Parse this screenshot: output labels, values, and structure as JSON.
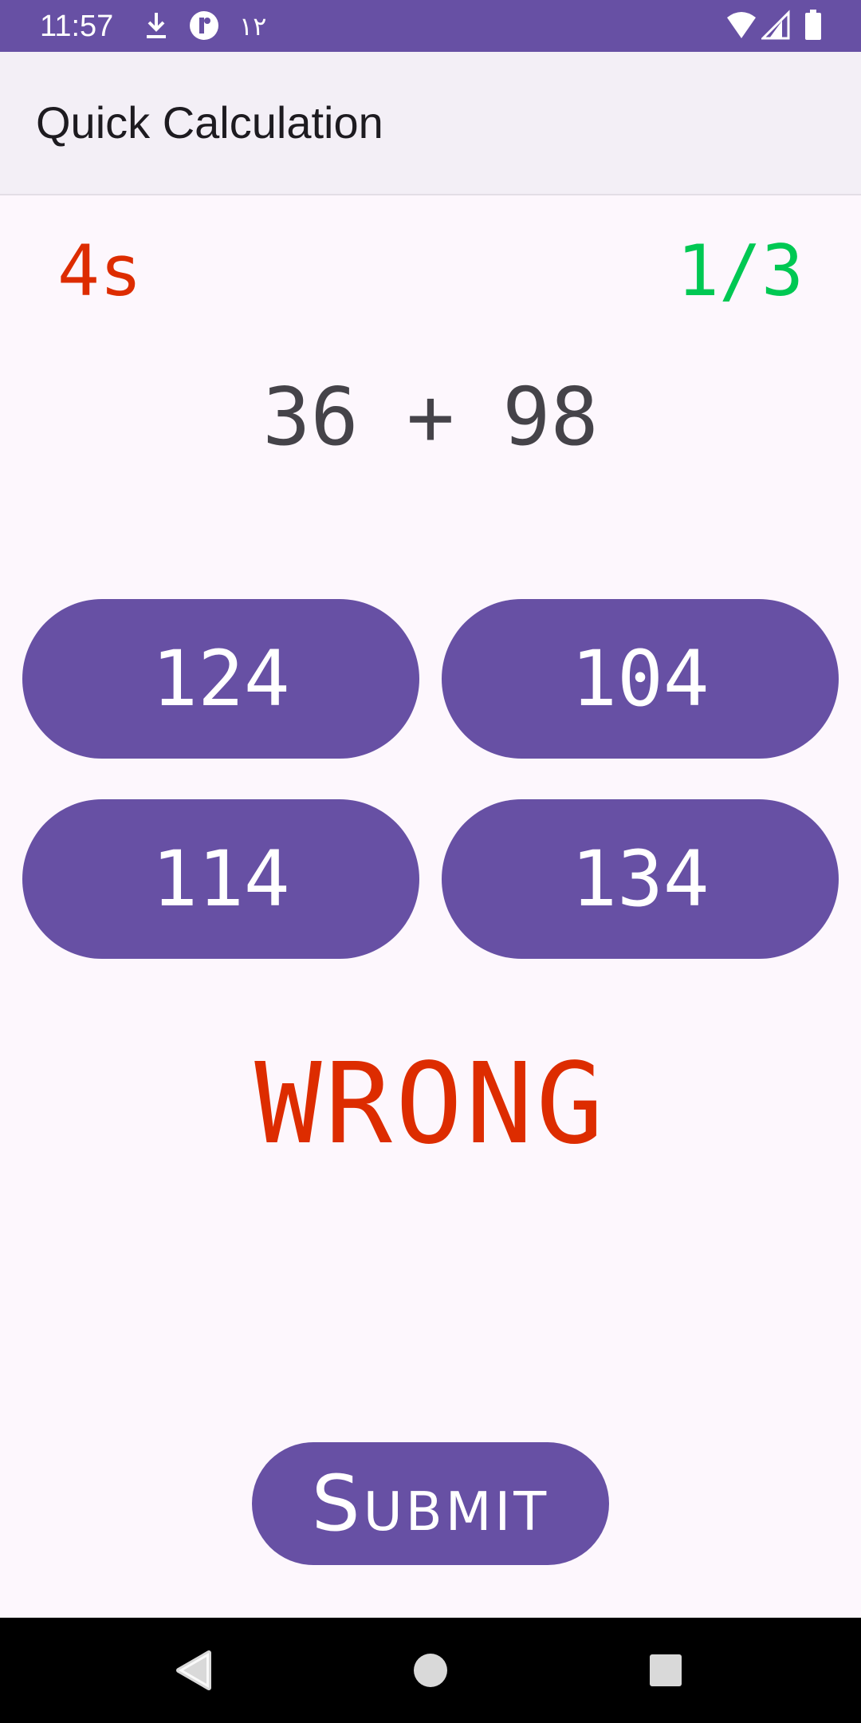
{
  "status_bar": {
    "time": "11:57",
    "extra_text": "١٢",
    "icons": [
      "download-icon",
      "app-notification-icon",
      "wifi-icon",
      "signal-icon",
      "battery-icon"
    ]
  },
  "app_bar": {
    "title": "Quick Calculation"
  },
  "game": {
    "timer": "4s",
    "progress": "1/3",
    "question": "36 + 98",
    "answers": [
      "124",
      "104",
      "114",
      "134"
    ],
    "result": "WRONG",
    "submit_label": "Submit"
  },
  "nav_bar": {
    "icons": [
      "back-icon",
      "home-icon",
      "recents-icon"
    ]
  },
  "colors": {
    "primary": "#6750A4",
    "timer": "#DD2C00",
    "progress": "#00C853",
    "result_wrong": "#DD2C00",
    "background": "#FDF7FD"
  }
}
